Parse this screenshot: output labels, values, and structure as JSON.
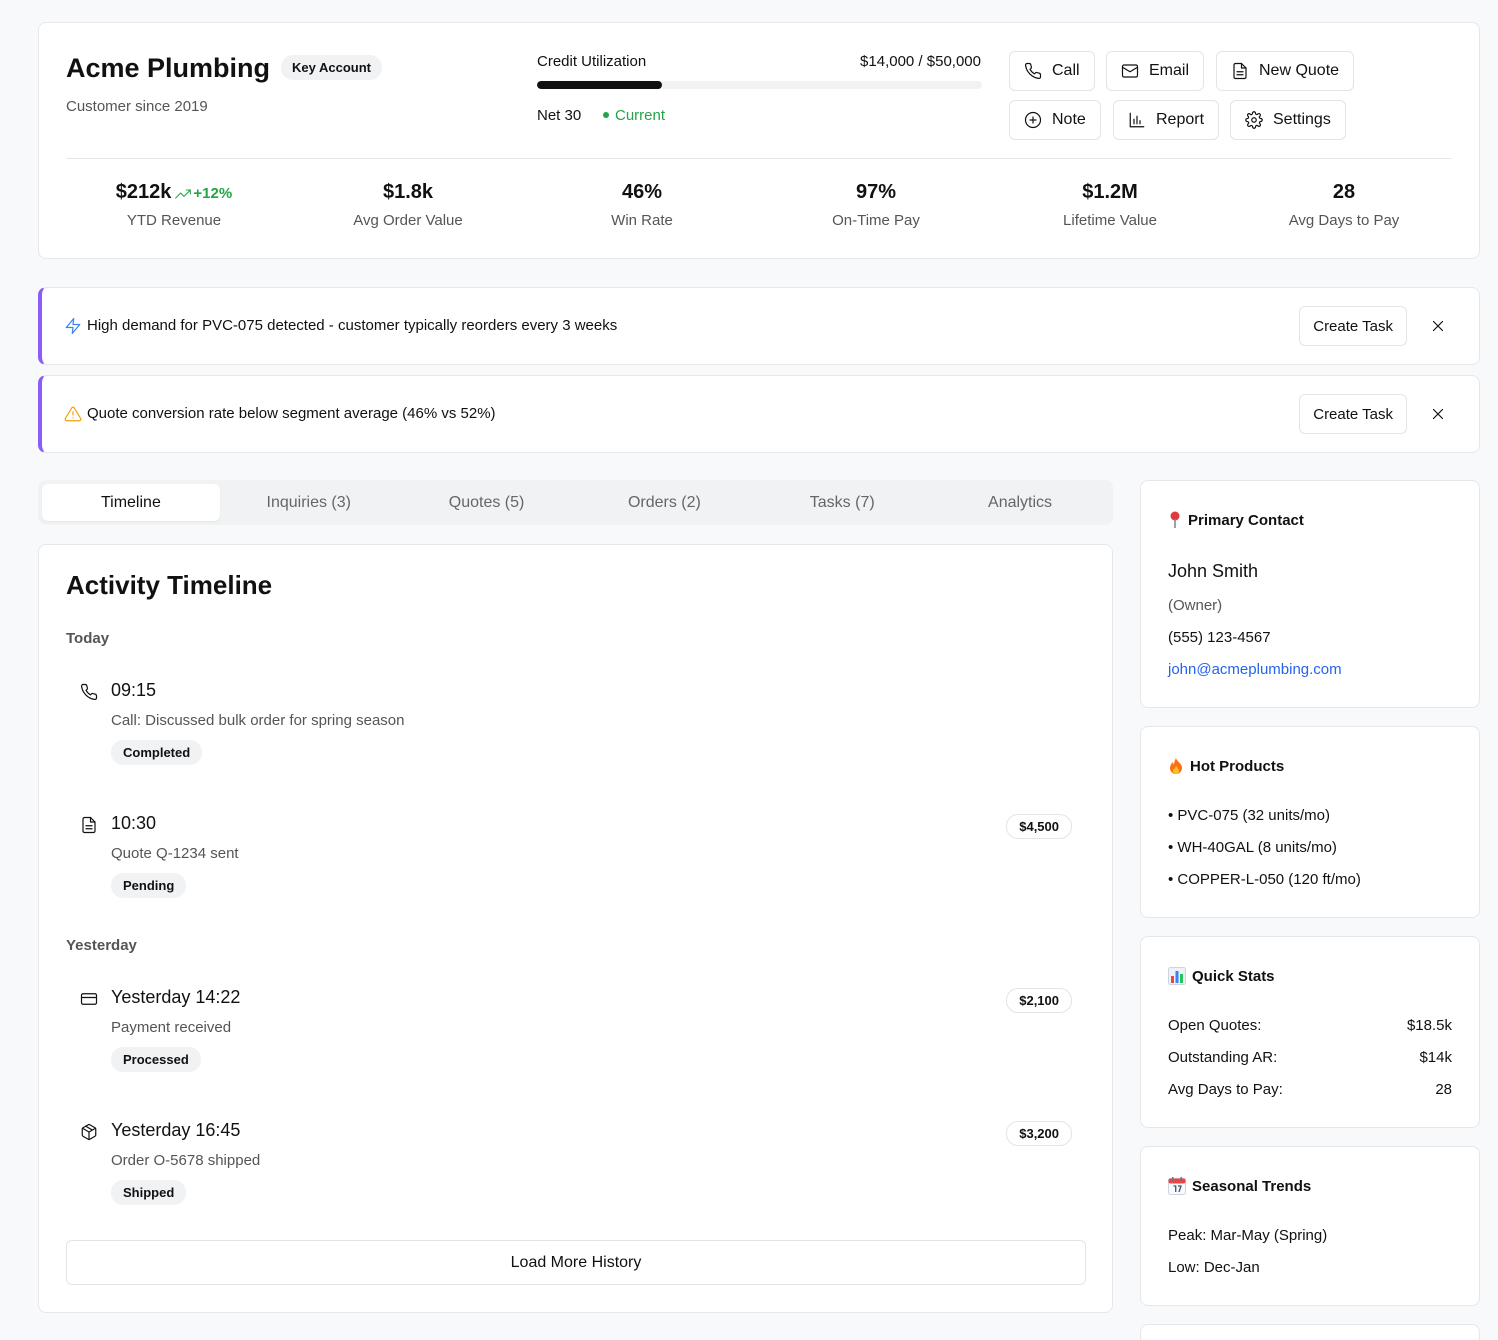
{
  "header": {
    "company": "Acme Plumbing",
    "badge": "Key Account",
    "since": "Customer since 2019",
    "credit": {
      "label": "Credit Utilization",
      "amount": "$14,000 / $50,000",
      "utilization": 0.28,
      "terms": "Net 30",
      "status": "Current"
    },
    "buttons": {
      "call": "Call",
      "email": "Email",
      "new_quote": "New Quote",
      "note": "Note",
      "report": "Report",
      "settings": "Settings"
    },
    "metrics": [
      {
        "value": "$212k",
        "trend": "+12%",
        "label": "YTD Revenue"
      },
      {
        "value": "$1.8k",
        "label": "Avg Order Value"
      },
      {
        "value": "46%",
        "label": "Win Rate"
      },
      {
        "value": "97%",
        "label": "On-Time Pay"
      },
      {
        "value": "$1.2M",
        "label": "Lifetime Value"
      },
      {
        "value": "28",
        "label": "Avg Days to Pay"
      }
    ]
  },
  "alerts": [
    {
      "text": "High demand for PVC-075 detected - customer typically reorders every 3 weeks",
      "icon": "lightning-icon",
      "action": "Create Task"
    },
    {
      "text": "Quote conversion rate below segment average (46% vs 52%)",
      "icon": "warning-icon",
      "action": "Create Task"
    }
  ],
  "tabs": [
    "Timeline",
    "Inquiries (3)",
    "Quotes (5)",
    "Orders (2)",
    "Tasks (7)",
    "Analytics"
  ],
  "active_tab": "Timeline",
  "timeline": {
    "title": "Activity Timeline",
    "groups": [
      "Today",
      "Yesterday"
    ],
    "events": [
      {
        "icon": "phone-icon",
        "time": "09:15",
        "desc": "Call: Discussed bulk order for spring season",
        "badge": "Completed"
      },
      {
        "icon": "document-icon",
        "time": "10:30",
        "desc": "Quote Q-1234 sent",
        "badge": "Pending",
        "amount": "$4,500"
      },
      {
        "icon": "credit-card-icon",
        "time": "Yesterday 14:22",
        "desc": "Payment received",
        "badge": "Processed",
        "amount": "$2,100"
      },
      {
        "icon": "package-icon",
        "time": "Yesterday 16:45",
        "desc": "Order O-5678 shipped",
        "badge": "Shipped",
        "amount": "$3,200"
      }
    ],
    "load_more": "Load More History"
  },
  "sidebar": {
    "contact": {
      "title": "Primary Contact",
      "icon": "pin-icon",
      "name": "John Smith",
      "role": "(Owner)",
      "phone": "(555) 123-4567",
      "email": "john@acmeplumbing.com"
    },
    "hot_products": {
      "title": "Hot Products",
      "icon": "fire-icon",
      "items": [
        "• PVC-075 (32 units/mo)",
        "• WH-40GAL (8 units/mo)",
        "• COPPER-L-050 (120 ft/mo)"
      ]
    },
    "quick_stats": {
      "title": "Quick Stats",
      "icon": "bar-chart-icon",
      "rows": [
        {
          "label": "Open Quotes:",
          "value": "$18.5k"
        },
        {
          "label": "Outstanding AR:",
          "value": "$14k"
        },
        {
          "label": "Avg Days to Pay:",
          "value": "28"
        }
      ]
    },
    "seasonal": {
      "title": "Seasonal Trends",
      "icon": "calendar-icon",
      "peak": "Peak: Mar-May (Spring)",
      "low": "Low: Dec-Jan"
    }
  },
  "colors": {
    "accent": "#8b5cf6",
    "positive": "#22a447",
    "link": "#2563eb",
    "lightning": "#3b82f6",
    "warning": "#f59e0b"
  }
}
